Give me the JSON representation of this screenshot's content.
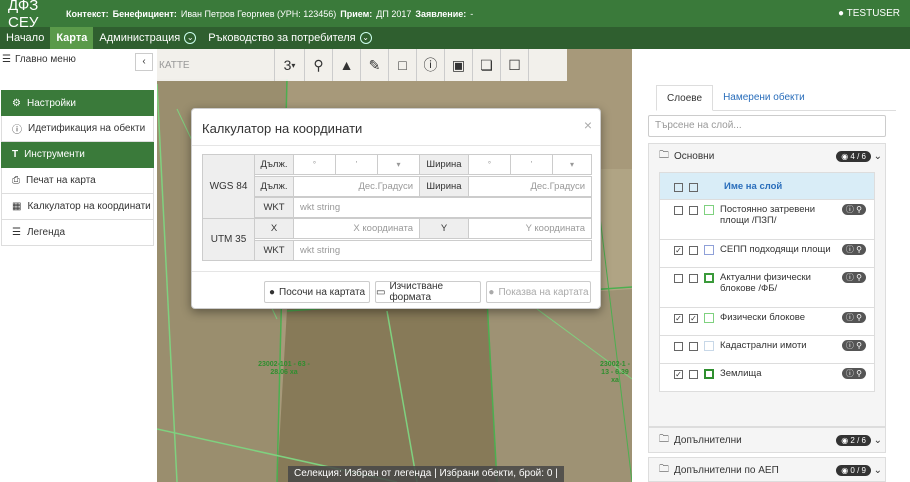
{
  "topbar": {
    "brand": "ДФЗ СЕУ",
    "context_label": "Контекст:",
    "beneficiary_label": "Бенефициент:",
    "beneficiary_value": "Иван Петров Георгиев (УРН: 123456)",
    "intake_label": "Прием:",
    "intake_value": "ДП 2017",
    "application_label": "Заявление:",
    "application_value": "-",
    "user": "TESTUSER"
  },
  "navbar": {
    "items": [
      {
        "label": "Начало"
      },
      {
        "label": "Карта"
      },
      {
        "label": "Администрация"
      },
      {
        "label": "Ръководство за потребителя"
      }
    ]
  },
  "leftpanel": {
    "title": "Главно меню",
    "items": [
      {
        "label": "Настройки",
        "icon": "gears-icon"
      },
      {
        "label": "Идетификация на обекти",
        "icon": "info-icon"
      },
      {
        "label": "Инструменти",
        "icon": "tools-icon"
      },
      {
        "label": "Печат на карта",
        "icon": "print-icon"
      },
      {
        "label": "Калкулатор на координати",
        "icon": "calculator-icon"
      },
      {
        "label": "Легенда",
        "icon": "list-icon"
      }
    ]
  },
  "toolbar": {
    "search_placeholder": "КАТТЕ",
    "selector_value": "3"
  },
  "modal": {
    "title": "Калкулатор на координати",
    "wgs_label": "WGS 84",
    "utm_label": "UTM 35",
    "lon_label": "Дълж.",
    "lat_label": "Ширина",
    "deg_symbol": "°",
    "min_symbol": "'",
    "dec_placeholder": "Дес.Градуси",
    "wkt_label": "WKT",
    "wkt_placeholder": "wkt string",
    "x_label": "X",
    "y_label": "Y",
    "x_placeholder": "X координата",
    "y_placeholder": "Y координата",
    "btn_show": "Посочи на картата",
    "btn_clear": "Изчистване формата",
    "btn_display": "Показва на картата"
  },
  "rightpanel": {
    "tab_layers": "Слоеве",
    "tab_found": "Намерени обекти",
    "search_placeholder": "Търсене на слой...",
    "group_main": "Основни",
    "group_main_count": "4 / 6",
    "layer_header": "Име на слой",
    "layers": [
      {
        "name": "Постоянно затревени площи /ПЗП/",
        "checked": false,
        "color": "#7fd17f"
      },
      {
        "name": "СЕПП подходящи площи",
        "checked": true,
        "color": "#8fa0d8"
      },
      {
        "name": "Актуални физически блокове /ФБ/",
        "checked": false,
        "color": "#3a9a3a"
      },
      {
        "name": "Физически блокове",
        "checked": true,
        "color": "#7fd17f"
      },
      {
        "name": "Кадастрални имоти",
        "checked": false,
        "color": "#c8d8e8"
      },
      {
        "name": "Землища",
        "checked": true,
        "color": "#2f8f2f"
      }
    ],
    "group_additional": "Допълнителни",
    "group_additional_count": "2 / 6",
    "group_aep": "Допълнителни по АЕП",
    "group_aep_count": "0 / 9"
  },
  "map": {
    "label_1": "23002-101 - 63 - 28.06 xa",
    "label_2": "23002-1 - 13 - 6.39 xa"
  },
  "statusbar": {
    "text": "Селекция: Избран от легенда  |  Избрани обекти, брой: 0  |"
  }
}
